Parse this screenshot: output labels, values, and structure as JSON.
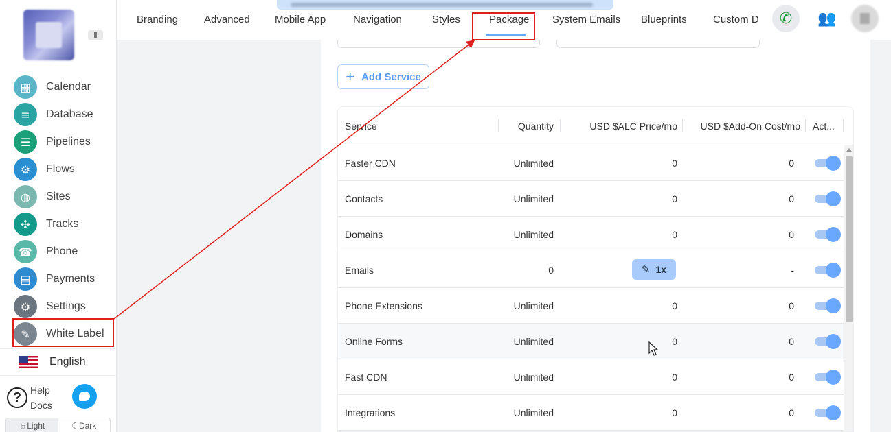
{
  "sidebar": {
    "items": [
      {
        "label": "Calendar",
        "icon": "calendar-icon",
        "color": "#5bb5c8",
        "glyph": "▦"
      },
      {
        "label": "Database",
        "icon": "database-icon",
        "color": "#2aa3a3",
        "glyph": "≡"
      },
      {
        "label": "Pipelines",
        "icon": "pipelines-icon",
        "color": "#1ba07a",
        "glyph": "☰"
      },
      {
        "label": "Flows",
        "icon": "flows-icon",
        "color": "#2a8fd0",
        "glyph": "⚙"
      },
      {
        "label": "Sites",
        "icon": "sites-icon",
        "color": "#7ab8b0",
        "glyph": "◍"
      },
      {
        "label": "Tracks",
        "icon": "tracks-icon",
        "color": "#139a8a",
        "glyph": "✣"
      },
      {
        "label": "Phone",
        "icon": "phone-icon",
        "color": "#5ab8a8",
        "glyph": "☎"
      },
      {
        "label": "Payments",
        "icon": "payments-icon",
        "color": "#2f8bd0",
        "glyph": "▤"
      },
      {
        "label": "Settings",
        "icon": "settings-icon",
        "color": "#6b7580",
        "glyph": "⚙"
      },
      {
        "label": "White Label",
        "icon": "white-label-icon",
        "color": "#7a8590",
        "glyph": "✎"
      }
    ],
    "language": "English",
    "help_line1": "Help",
    "help_line2": "Docs",
    "theme_light": "☼Light",
    "theme_dark": "☾Dark"
  },
  "topnav": {
    "tabs": [
      {
        "label": "Branding"
      },
      {
        "label": "Advanced"
      },
      {
        "label": "Mobile App"
      },
      {
        "label": "Navigation"
      },
      {
        "label": "Styles"
      },
      {
        "label": "Package"
      },
      {
        "label": "System Emails"
      },
      {
        "label": "Blueprints"
      },
      {
        "label": "Custom D"
      }
    ],
    "active_tab": "Package"
  },
  "package": {
    "add_service_label": "Add Service",
    "columns": [
      "Service",
      "Quantity",
      "USD $ALC Price/mo",
      "USD $Add-On Cost/mo",
      "Act..."
    ],
    "rows": [
      {
        "service": "Faster CDN",
        "quantity": "Unlimited",
        "alc_price": "0",
        "addon_cost": "0",
        "active": true
      },
      {
        "service": "Contacts",
        "quantity": "Unlimited",
        "alc_price": "0",
        "addon_cost": "0",
        "active": true
      },
      {
        "service": "Domains",
        "quantity": "Unlimited",
        "alc_price": "0",
        "addon_cost": "0",
        "active": true
      },
      {
        "service": "Emails",
        "quantity": "0",
        "alc_price": "",
        "addon_cost": "-",
        "active": true
      },
      {
        "service": "Phone Extensions",
        "quantity": "Unlimited",
        "alc_price": "0",
        "addon_cost": "0",
        "active": true
      },
      {
        "service": "Online Forms",
        "quantity": "Unlimited",
        "alc_price": "0",
        "addon_cost": "0",
        "active": true
      },
      {
        "service": "Fast CDN",
        "quantity": "Unlimited",
        "alc_price": "0",
        "addon_cost": "0",
        "active": true
      },
      {
        "service": "Integrations",
        "quantity": "Unlimited",
        "alc_price": "0",
        "addon_cost": "0",
        "active": true
      }
    ],
    "edit_badge_label": "1x"
  },
  "colors": {
    "accent": "#6aa7ff",
    "annotation": "#e0201c"
  }
}
